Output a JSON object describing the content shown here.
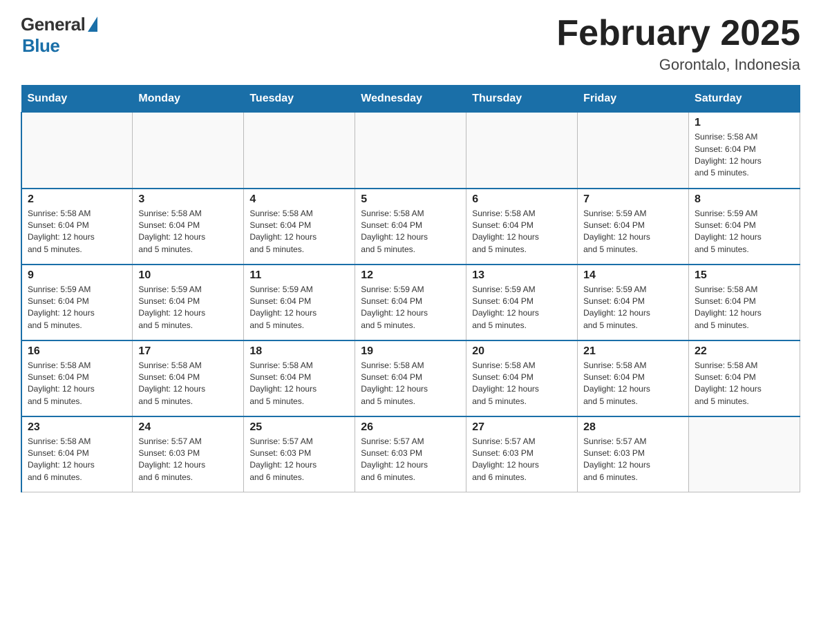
{
  "logo": {
    "general": "General",
    "blue": "Blue"
  },
  "header": {
    "title": "February 2025",
    "subtitle": "Gorontalo, Indonesia"
  },
  "days": {
    "headers": [
      "Sunday",
      "Monday",
      "Tuesday",
      "Wednesday",
      "Thursday",
      "Friday",
      "Saturday"
    ]
  },
  "weeks": [
    {
      "cells": [
        {
          "day": "",
          "info": ""
        },
        {
          "day": "",
          "info": ""
        },
        {
          "day": "",
          "info": ""
        },
        {
          "day": "",
          "info": ""
        },
        {
          "day": "",
          "info": ""
        },
        {
          "day": "",
          "info": ""
        },
        {
          "day": "1",
          "info": "Sunrise: 5:58 AM\nSunset: 6:04 PM\nDaylight: 12 hours\nand 5 minutes."
        }
      ]
    },
    {
      "cells": [
        {
          "day": "2",
          "info": "Sunrise: 5:58 AM\nSunset: 6:04 PM\nDaylight: 12 hours\nand 5 minutes."
        },
        {
          "day": "3",
          "info": "Sunrise: 5:58 AM\nSunset: 6:04 PM\nDaylight: 12 hours\nand 5 minutes."
        },
        {
          "day": "4",
          "info": "Sunrise: 5:58 AM\nSunset: 6:04 PM\nDaylight: 12 hours\nand 5 minutes."
        },
        {
          "day": "5",
          "info": "Sunrise: 5:58 AM\nSunset: 6:04 PM\nDaylight: 12 hours\nand 5 minutes."
        },
        {
          "day": "6",
          "info": "Sunrise: 5:58 AM\nSunset: 6:04 PM\nDaylight: 12 hours\nand 5 minutes."
        },
        {
          "day": "7",
          "info": "Sunrise: 5:59 AM\nSunset: 6:04 PM\nDaylight: 12 hours\nand 5 minutes."
        },
        {
          "day": "8",
          "info": "Sunrise: 5:59 AM\nSunset: 6:04 PM\nDaylight: 12 hours\nand 5 minutes."
        }
      ]
    },
    {
      "cells": [
        {
          "day": "9",
          "info": "Sunrise: 5:59 AM\nSunset: 6:04 PM\nDaylight: 12 hours\nand 5 minutes."
        },
        {
          "day": "10",
          "info": "Sunrise: 5:59 AM\nSunset: 6:04 PM\nDaylight: 12 hours\nand 5 minutes."
        },
        {
          "day": "11",
          "info": "Sunrise: 5:59 AM\nSunset: 6:04 PM\nDaylight: 12 hours\nand 5 minutes."
        },
        {
          "day": "12",
          "info": "Sunrise: 5:59 AM\nSunset: 6:04 PM\nDaylight: 12 hours\nand 5 minutes."
        },
        {
          "day": "13",
          "info": "Sunrise: 5:59 AM\nSunset: 6:04 PM\nDaylight: 12 hours\nand 5 minutes."
        },
        {
          "day": "14",
          "info": "Sunrise: 5:59 AM\nSunset: 6:04 PM\nDaylight: 12 hours\nand 5 minutes."
        },
        {
          "day": "15",
          "info": "Sunrise: 5:58 AM\nSunset: 6:04 PM\nDaylight: 12 hours\nand 5 minutes."
        }
      ]
    },
    {
      "cells": [
        {
          "day": "16",
          "info": "Sunrise: 5:58 AM\nSunset: 6:04 PM\nDaylight: 12 hours\nand 5 minutes."
        },
        {
          "day": "17",
          "info": "Sunrise: 5:58 AM\nSunset: 6:04 PM\nDaylight: 12 hours\nand 5 minutes."
        },
        {
          "day": "18",
          "info": "Sunrise: 5:58 AM\nSunset: 6:04 PM\nDaylight: 12 hours\nand 5 minutes."
        },
        {
          "day": "19",
          "info": "Sunrise: 5:58 AM\nSunset: 6:04 PM\nDaylight: 12 hours\nand 5 minutes."
        },
        {
          "day": "20",
          "info": "Sunrise: 5:58 AM\nSunset: 6:04 PM\nDaylight: 12 hours\nand 5 minutes."
        },
        {
          "day": "21",
          "info": "Sunrise: 5:58 AM\nSunset: 6:04 PM\nDaylight: 12 hours\nand 5 minutes."
        },
        {
          "day": "22",
          "info": "Sunrise: 5:58 AM\nSunset: 6:04 PM\nDaylight: 12 hours\nand 5 minutes."
        }
      ]
    },
    {
      "cells": [
        {
          "day": "23",
          "info": "Sunrise: 5:58 AM\nSunset: 6:04 PM\nDaylight: 12 hours\nand 6 minutes."
        },
        {
          "day": "24",
          "info": "Sunrise: 5:57 AM\nSunset: 6:03 PM\nDaylight: 12 hours\nand 6 minutes."
        },
        {
          "day": "25",
          "info": "Sunrise: 5:57 AM\nSunset: 6:03 PM\nDaylight: 12 hours\nand 6 minutes."
        },
        {
          "day": "26",
          "info": "Sunrise: 5:57 AM\nSunset: 6:03 PM\nDaylight: 12 hours\nand 6 minutes."
        },
        {
          "day": "27",
          "info": "Sunrise: 5:57 AM\nSunset: 6:03 PM\nDaylight: 12 hours\nand 6 minutes."
        },
        {
          "day": "28",
          "info": "Sunrise: 5:57 AM\nSunset: 6:03 PM\nDaylight: 12 hours\nand 6 minutes."
        },
        {
          "day": "",
          "info": ""
        }
      ]
    }
  ],
  "colors": {
    "header_bg": "#1a6fa8",
    "header_text": "#ffffff",
    "border": "#bbbbbb"
  }
}
